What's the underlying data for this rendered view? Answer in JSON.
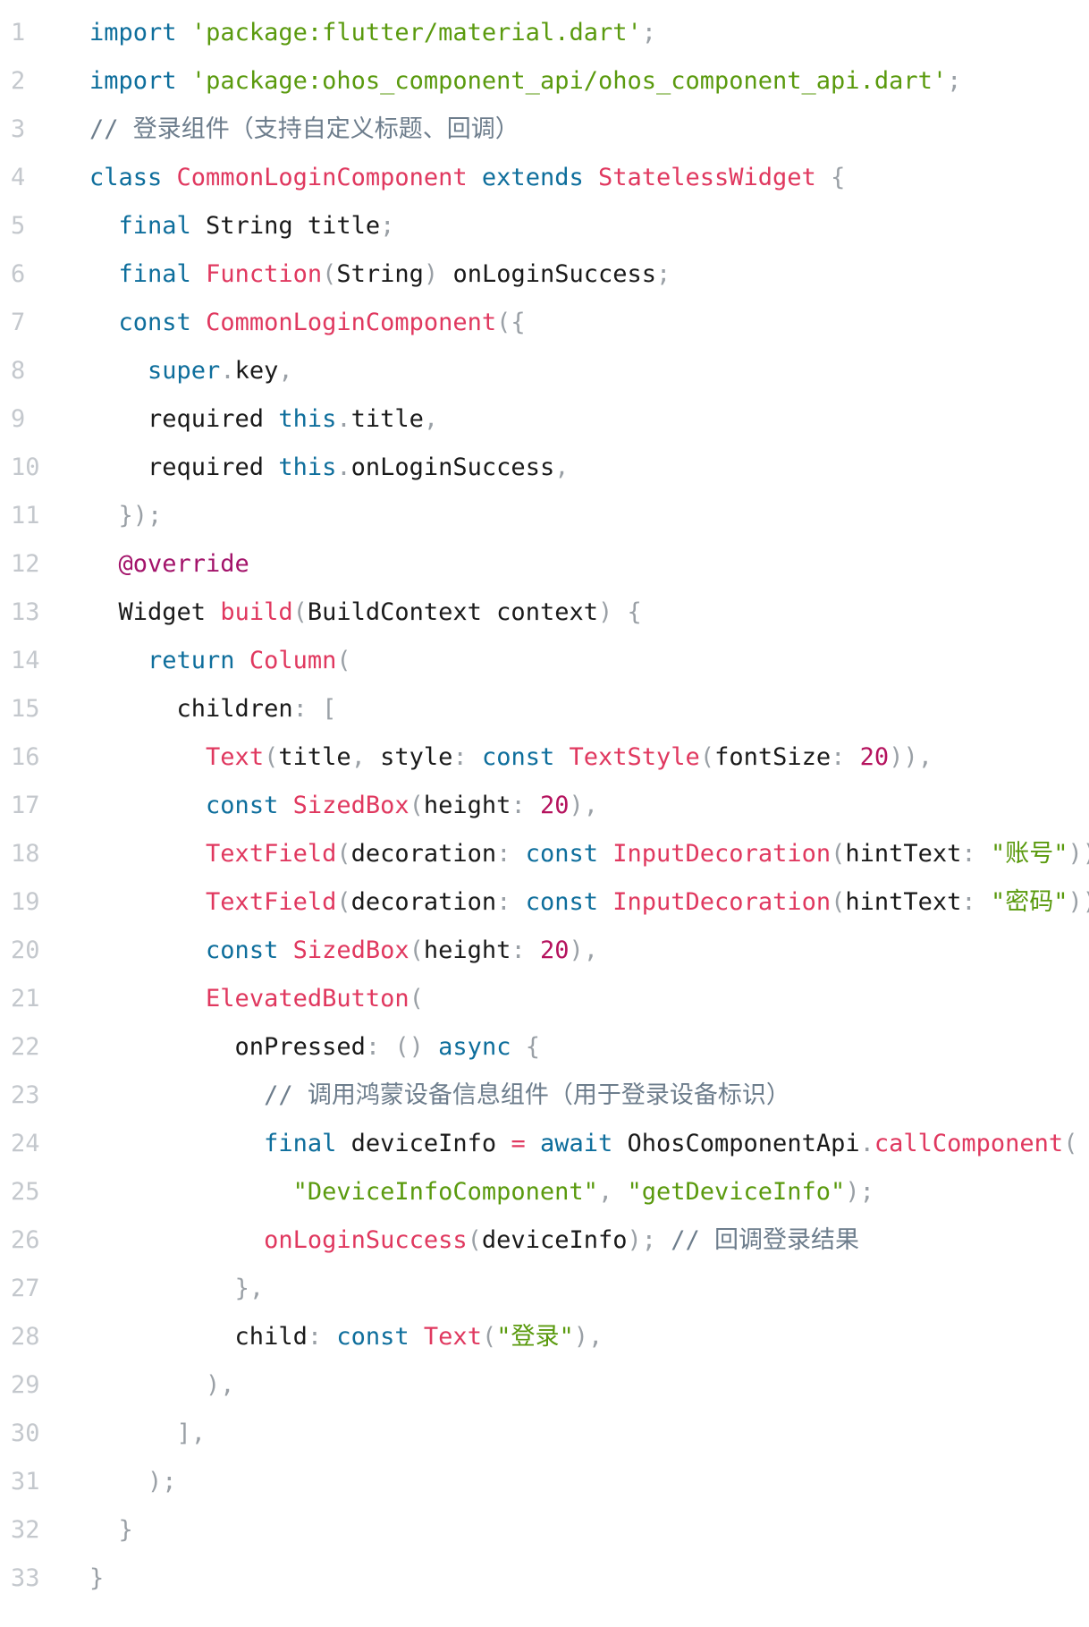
{
  "line_numbers": [
    "1",
    "2",
    "3",
    "4",
    "5",
    "6",
    "7",
    "8",
    "9",
    "10",
    "11",
    "12",
    "13",
    "14",
    "15",
    "16",
    "17",
    "18",
    "19",
    "20",
    "21",
    "22",
    "23",
    "24",
    "25",
    "26",
    "27",
    "28",
    "29",
    "30",
    "31",
    "32",
    "33"
  ],
  "code_lines": [
    {
      "tokens": [
        {
          "t": "kw",
          "v": "import"
        },
        {
          "t": "pl",
          "v": " "
        },
        {
          "t": "str",
          "v": "'package:flutter/material.dart'"
        },
        {
          "t": "pu",
          "v": ";"
        }
      ]
    },
    {
      "tokens": [
        {
          "t": "kw",
          "v": "import"
        },
        {
          "t": "pl",
          "v": " "
        },
        {
          "t": "str",
          "v": "'package:ohos_component_api/ohos_component_api.dart'"
        },
        {
          "t": "pu",
          "v": ";"
        }
      ]
    },
    {
      "tokens": [
        {
          "t": "cm",
          "v": "// 登录组件（支持自定义标题、回调）"
        }
      ]
    },
    {
      "tokens": [
        {
          "t": "kw",
          "v": "class"
        },
        {
          "t": "pl",
          "v": " "
        },
        {
          "t": "ty",
          "v": "CommonLoginComponent"
        },
        {
          "t": "pl",
          "v": " "
        },
        {
          "t": "kw",
          "v": "extends"
        },
        {
          "t": "pl",
          "v": " "
        },
        {
          "t": "ty",
          "v": "StatelessWidget"
        },
        {
          "t": "pl",
          "v": " "
        },
        {
          "t": "pu",
          "v": "{"
        }
      ]
    },
    {
      "tokens": [
        {
          "t": "pl",
          "v": "  "
        },
        {
          "t": "kw",
          "v": "final"
        },
        {
          "t": "pl",
          "v": " String title"
        },
        {
          "t": "pu",
          "v": ";"
        }
      ]
    },
    {
      "tokens": [
        {
          "t": "pl",
          "v": "  "
        },
        {
          "t": "kw",
          "v": "final"
        },
        {
          "t": "pl",
          "v": " "
        },
        {
          "t": "ty",
          "v": "Function"
        },
        {
          "t": "pu",
          "v": "("
        },
        {
          "t": "pl",
          "v": "String"
        },
        {
          "t": "pu",
          "v": ")"
        },
        {
          "t": "pl",
          "v": " onLoginSuccess"
        },
        {
          "t": "pu",
          "v": ";"
        }
      ]
    },
    {
      "tokens": [
        {
          "t": "pl",
          "v": "  "
        },
        {
          "t": "kw",
          "v": "const"
        },
        {
          "t": "pl",
          "v": " "
        },
        {
          "t": "ty",
          "v": "CommonLoginComponent"
        },
        {
          "t": "pu",
          "v": "({"
        }
      ]
    },
    {
      "tokens": [
        {
          "t": "pl",
          "v": "    "
        },
        {
          "t": "kw",
          "v": "super"
        },
        {
          "t": "pu",
          "v": "."
        },
        {
          "t": "pl",
          "v": "key"
        },
        {
          "t": "pu",
          "v": ","
        }
      ]
    },
    {
      "tokens": [
        {
          "t": "pl",
          "v": "    required "
        },
        {
          "t": "kw",
          "v": "this"
        },
        {
          "t": "pu",
          "v": "."
        },
        {
          "t": "pl",
          "v": "title"
        },
        {
          "t": "pu",
          "v": ","
        }
      ]
    },
    {
      "tokens": [
        {
          "t": "pl",
          "v": "    required "
        },
        {
          "t": "kw",
          "v": "this"
        },
        {
          "t": "pu",
          "v": "."
        },
        {
          "t": "pl",
          "v": "onLoginSuccess"
        },
        {
          "t": "pu",
          "v": ","
        }
      ]
    },
    {
      "tokens": [
        {
          "t": "pl",
          "v": "  "
        },
        {
          "t": "pu",
          "v": "});"
        }
      ]
    },
    {
      "tokens": [
        {
          "t": "pl",
          "v": "  "
        },
        {
          "t": "ann",
          "v": "@override"
        }
      ]
    },
    {
      "tokens": [
        {
          "t": "pl",
          "v": "  Widget "
        },
        {
          "t": "ty",
          "v": "build"
        },
        {
          "t": "pu",
          "v": "("
        },
        {
          "t": "pl",
          "v": "BuildContext context"
        },
        {
          "t": "pu",
          "v": ")"
        },
        {
          "t": "pl",
          "v": " "
        },
        {
          "t": "pu",
          "v": "{"
        }
      ]
    },
    {
      "tokens": [
        {
          "t": "pl",
          "v": "    "
        },
        {
          "t": "kw",
          "v": "return"
        },
        {
          "t": "pl",
          "v": " "
        },
        {
          "t": "ty",
          "v": "Column"
        },
        {
          "t": "pu",
          "v": "("
        }
      ]
    },
    {
      "tokens": [
        {
          "t": "pl",
          "v": "      children"
        },
        {
          "t": "pu",
          "v": ":"
        },
        {
          "t": "pl",
          "v": " "
        },
        {
          "t": "pu",
          "v": "["
        }
      ]
    },
    {
      "tokens": [
        {
          "t": "pl",
          "v": "        "
        },
        {
          "t": "ty",
          "v": "Text"
        },
        {
          "t": "pu",
          "v": "("
        },
        {
          "t": "pl",
          "v": "title"
        },
        {
          "t": "pu",
          "v": ","
        },
        {
          "t": "pl",
          "v": " style"
        },
        {
          "t": "pu",
          "v": ":"
        },
        {
          "t": "pl",
          "v": " "
        },
        {
          "t": "kw",
          "v": "const"
        },
        {
          "t": "pl",
          "v": " "
        },
        {
          "t": "ty",
          "v": "TextStyle"
        },
        {
          "t": "pu",
          "v": "("
        },
        {
          "t": "pl",
          "v": "fontSize"
        },
        {
          "t": "pu",
          "v": ":"
        },
        {
          "t": "pl",
          "v": " "
        },
        {
          "t": "num",
          "v": "20"
        },
        {
          "t": "pu",
          "v": ")),"
        }
      ]
    },
    {
      "tokens": [
        {
          "t": "pl",
          "v": "        "
        },
        {
          "t": "kw",
          "v": "const"
        },
        {
          "t": "pl",
          "v": " "
        },
        {
          "t": "ty",
          "v": "SizedBox"
        },
        {
          "t": "pu",
          "v": "("
        },
        {
          "t": "pl",
          "v": "height"
        },
        {
          "t": "pu",
          "v": ":"
        },
        {
          "t": "pl",
          "v": " "
        },
        {
          "t": "num",
          "v": "20"
        },
        {
          "t": "pu",
          "v": "),"
        }
      ]
    },
    {
      "tokens": [
        {
          "t": "pl",
          "v": "        "
        },
        {
          "t": "ty",
          "v": "TextField"
        },
        {
          "t": "pu",
          "v": "("
        },
        {
          "t": "pl",
          "v": "decoration"
        },
        {
          "t": "pu",
          "v": ":"
        },
        {
          "t": "pl",
          "v": " "
        },
        {
          "t": "kw",
          "v": "const"
        },
        {
          "t": "pl",
          "v": " "
        },
        {
          "t": "ty",
          "v": "InputDecoration"
        },
        {
          "t": "pu",
          "v": "("
        },
        {
          "t": "pl",
          "v": "hintText"
        },
        {
          "t": "pu",
          "v": ":"
        },
        {
          "t": "pl",
          "v": " "
        },
        {
          "t": "str",
          "v": "\"账号\""
        },
        {
          "t": "pu",
          "v": ")),"
        }
      ]
    },
    {
      "tokens": [
        {
          "t": "pl",
          "v": "        "
        },
        {
          "t": "ty",
          "v": "TextField"
        },
        {
          "t": "pu",
          "v": "("
        },
        {
          "t": "pl",
          "v": "decoration"
        },
        {
          "t": "pu",
          "v": ":"
        },
        {
          "t": "pl",
          "v": " "
        },
        {
          "t": "kw",
          "v": "const"
        },
        {
          "t": "pl",
          "v": " "
        },
        {
          "t": "ty",
          "v": "InputDecoration"
        },
        {
          "t": "pu",
          "v": "("
        },
        {
          "t": "pl",
          "v": "hintText"
        },
        {
          "t": "pu",
          "v": ":"
        },
        {
          "t": "pl",
          "v": " "
        },
        {
          "t": "str",
          "v": "\"密码\""
        },
        {
          "t": "pu",
          "v": ")),"
        }
      ]
    },
    {
      "tokens": [
        {
          "t": "pl",
          "v": "        "
        },
        {
          "t": "kw",
          "v": "const"
        },
        {
          "t": "pl",
          "v": " "
        },
        {
          "t": "ty",
          "v": "SizedBox"
        },
        {
          "t": "pu",
          "v": "("
        },
        {
          "t": "pl",
          "v": "height"
        },
        {
          "t": "pu",
          "v": ":"
        },
        {
          "t": "pl",
          "v": " "
        },
        {
          "t": "num",
          "v": "20"
        },
        {
          "t": "pu",
          "v": "),"
        }
      ]
    },
    {
      "tokens": [
        {
          "t": "pl",
          "v": "        "
        },
        {
          "t": "ty",
          "v": "ElevatedButton"
        },
        {
          "t": "pu",
          "v": "("
        }
      ]
    },
    {
      "tokens": [
        {
          "t": "pl",
          "v": "          onPressed"
        },
        {
          "t": "pu",
          "v": ":"
        },
        {
          "t": "pl",
          "v": " "
        },
        {
          "t": "pu",
          "v": "()"
        },
        {
          "t": "pl",
          "v": " "
        },
        {
          "t": "kw",
          "v": "async"
        },
        {
          "t": "pl",
          "v": " "
        },
        {
          "t": "pu",
          "v": "{"
        }
      ]
    },
    {
      "tokens": [
        {
          "t": "pl",
          "v": "            "
        },
        {
          "t": "cm",
          "v": "// 调用鸿蒙设备信息组件（用于登录设备标识）"
        }
      ]
    },
    {
      "tokens": [
        {
          "t": "pl",
          "v": "            "
        },
        {
          "t": "kw",
          "v": "final"
        },
        {
          "t": "pl",
          "v": " deviceInfo "
        },
        {
          "t": "ty",
          "v": "="
        },
        {
          "t": "pl",
          "v": " "
        },
        {
          "t": "kw",
          "v": "await"
        },
        {
          "t": "pl",
          "v": " OhosComponentApi"
        },
        {
          "t": "pu",
          "v": "."
        },
        {
          "t": "ty",
          "v": "callComponent"
        },
        {
          "t": "pu",
          "v": "("
        }
      ]
    },
    {
      "tokens": [
        {
          "t": "pl",
          "v": "              "
        },
        {
          "t": "str",
          "v": "\"DeviceInfoComponent\""
        },
        {
          "t": "pu",
          "v": ","
        },
        {
          "t": "pl",
          "v": " "
        },
        {
          "t": "str",
          "v": "\"getDeviceInfo\""
        },
        {
          "t": "pu",
          "v": ");"
        }
      ]
    },
    {
      "tokens": [
        {
          "t": "pl",
          "v": "            "
        },
        {
          "t": "ty",
          "v": "onLoginSuccess"
        },
        {
          "t": "pu",
          "v": "("
        },
        {
          "t": "pl",
          "v": "deviceInfo"
        },
        {
          "t": "pu",
          "v": ");"
        },
        {
          "t": "pl",
          "v": " "
        },
        {
          "t": "cm",
          "v": "// 回调登录结果"
        }
      ]
    },
    {
      "tokens": [
        {
          "t": "pl",
          "v": "          "
        },
        {
          "t": "pu",
          "v": "},"
        }
      ]
    },
    {
      "tokens": [
        {
          "t": "pl",
          "v": "          child"
        },
        {
          "t": "pu",
          "v": ":"
        },
        {
          "t": "pl",
          "v": " "
        },
        {
          "t": "kw",
          "v": "const"
        },
        {
          "t": "pl",
          "v": " "
        },
        {
          "t": "ty",
          "v": "Text"
        },
        {
          "t": "pu",
          "v": "("
        },
        {
          "t": "str",
          "v": "\"登录\""
        },
        {
          "t": "pu",
          "v": "),"
        }
      ]
    },
    {
      "tokens": [
        {
          "t": "pl",
          "v": "        "
        },
        {
          "t": "pu",
          "v": "),"
        }
      ]
    },
    {
      "tokens": [
        {
          "t": "pl",
          "v": "      "
        },
        {
          "t": "pu",
          "v": "],"
        }
      ]
    },
    {
      "tokens": [
        {
          "t": "pl",
          "v": "    "
        },
        {
          "t": "pu",
          "v": ");"
        }
      ]
    },
    {
      "tokens": [
        {
          "t": "pl",
          "v": "  "
        },
        {
          "t": "pu",
          "v": "}"
        }
      ]
    },
    {
      "tokens": [
        {
          "t": "pu",
          "v": "}"
        }
      ]
    }
  ],
  "colors": {
    "keyword": "#0e6e9c",
    "string": "#5a9a0e",
    "type_or_call": "#e0385f",
    "comment": "#6d7d8c",
    "number": "#b5135e",
    "annotation": "#a3136a",
    "punctuation": "#9aa0a6",
    "plain": "#1a1a1a",
    "line_number": "#c4c8cd",
    "background": "#ffffff"
  }
}
